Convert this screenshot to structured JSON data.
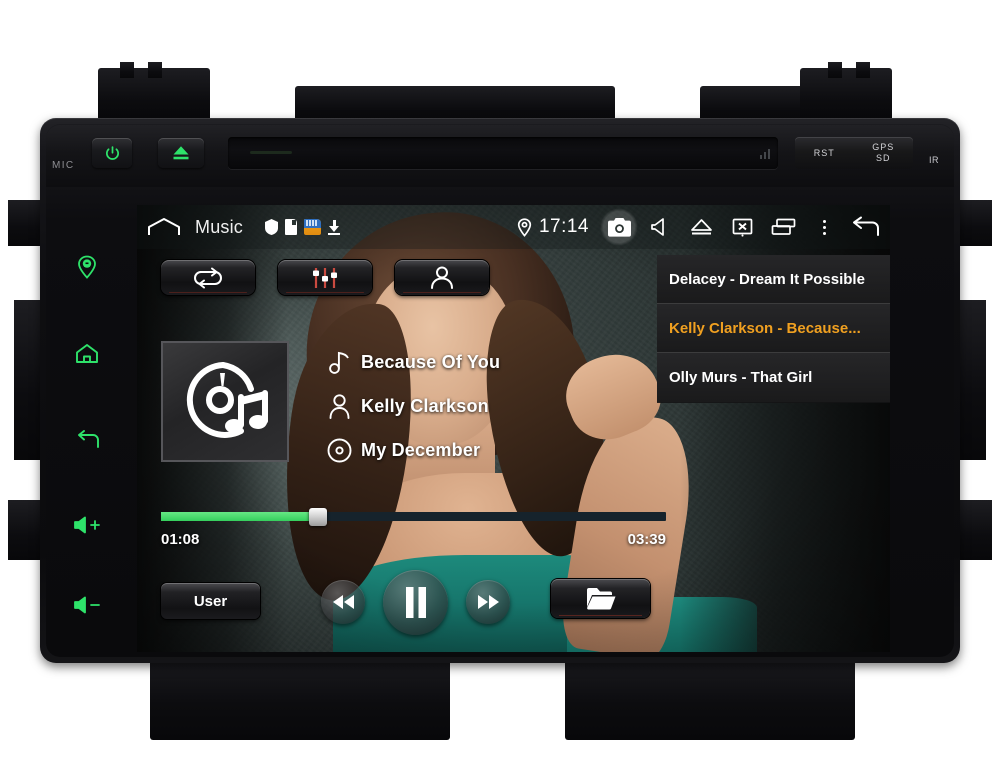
{
  "device": {
    "mic_label": "MIC",
    "power_button": "power-icon",
    "eject_button": "eject-icon",
    "rst_label": "RST",
    "gps_label": "GPS",
    "sd_label": "SD",
    "ir_label": "IR",
    "side_buttons": [
      {
        "name": "navigation",
        "label": "nav-pin-icon"
      },
      {
        "name": "home",
        "label": "home-icon"
      },
      {
        "name": "back",
        "label": "back-arrow-icon"
      },
      {
        "name": "volume-up",
        "label": "volume-up-icon"
      },
      {
        "name": "volume-down",
        "label": "volume-down-icon"
      }
    ]
  },
  "statusbar": {
    "home_icon": "home-icon",
    "title": "Music",
    "system_icons": [
      "shield-icon",
      "sd-card-icon",
      "sd-card-color-icon",
      "download-icon"
    ],
    "location_icon": "location-pin-icon",
    "time": "17:14",
    "buttons": [
      {
        "name": "camera",
        "icon": "camera-icon"
      },
      {
        "name": "mute",
        "icon": "speaker-mute-icon"
      },
      {
        "name": "eject",
        "icon": "eject-icon"
      },
      {
        "name": "screen-off",
        "icon": "screen-off-icon"
      },
      {
        "name": "recent-apps",
        "icon": "recent-apps-icon"
      },
      {
        "name": "overflow-menu",
        "icon": "more-vert-icon"
      },
      {
        "name": "back",
        "icon": "back-arrow-icon"
      }
    ]
  },
  "toolbar": {
    "repeat_label": "repeat-icon",
    "equalizer_label": "equalizer-icon",
    "artist_label": "person-icon"
  },
  "now_playing": {
    "album_art_icon": "cd-music-icon",
    "title": "Because Of You",
    "artist": "Kelly Clarkson",
    "album": "My December",
    "title_icon": "music-note-icon",
    "artist_icon": "person-icon",
    "album_icon": "disc-icon",
    "elapsed": "01:08",
    "duration": "03:39",
    "progress_percent": 31,
    "state": "playing"
  },
  "playlist": {
    "items": [
      {
        "label": "Delacey - Dream It Possible",
        "active": false
      },
      {
        "label": "Kelly Clarkson - Because...",
        "active": true
      },
      {
        "label": "Olly Murs - That Girl",
        "active": false
      }
    ]
  },
  "transport": {
    "user_label": "User",
    "prev_label": "rewind-icon",
    "play_label": "pause-icon",
    "next_label": "fast-forward-icon",
    "folder_label": "folder-icon"
  },
  "colors": {
    "accent_green": "#2ee36a",
    "progress_green": "#35cf5d",
    "active_track_orange": "#f0a020",
    "chassis_black": "#121215"
  }
}
